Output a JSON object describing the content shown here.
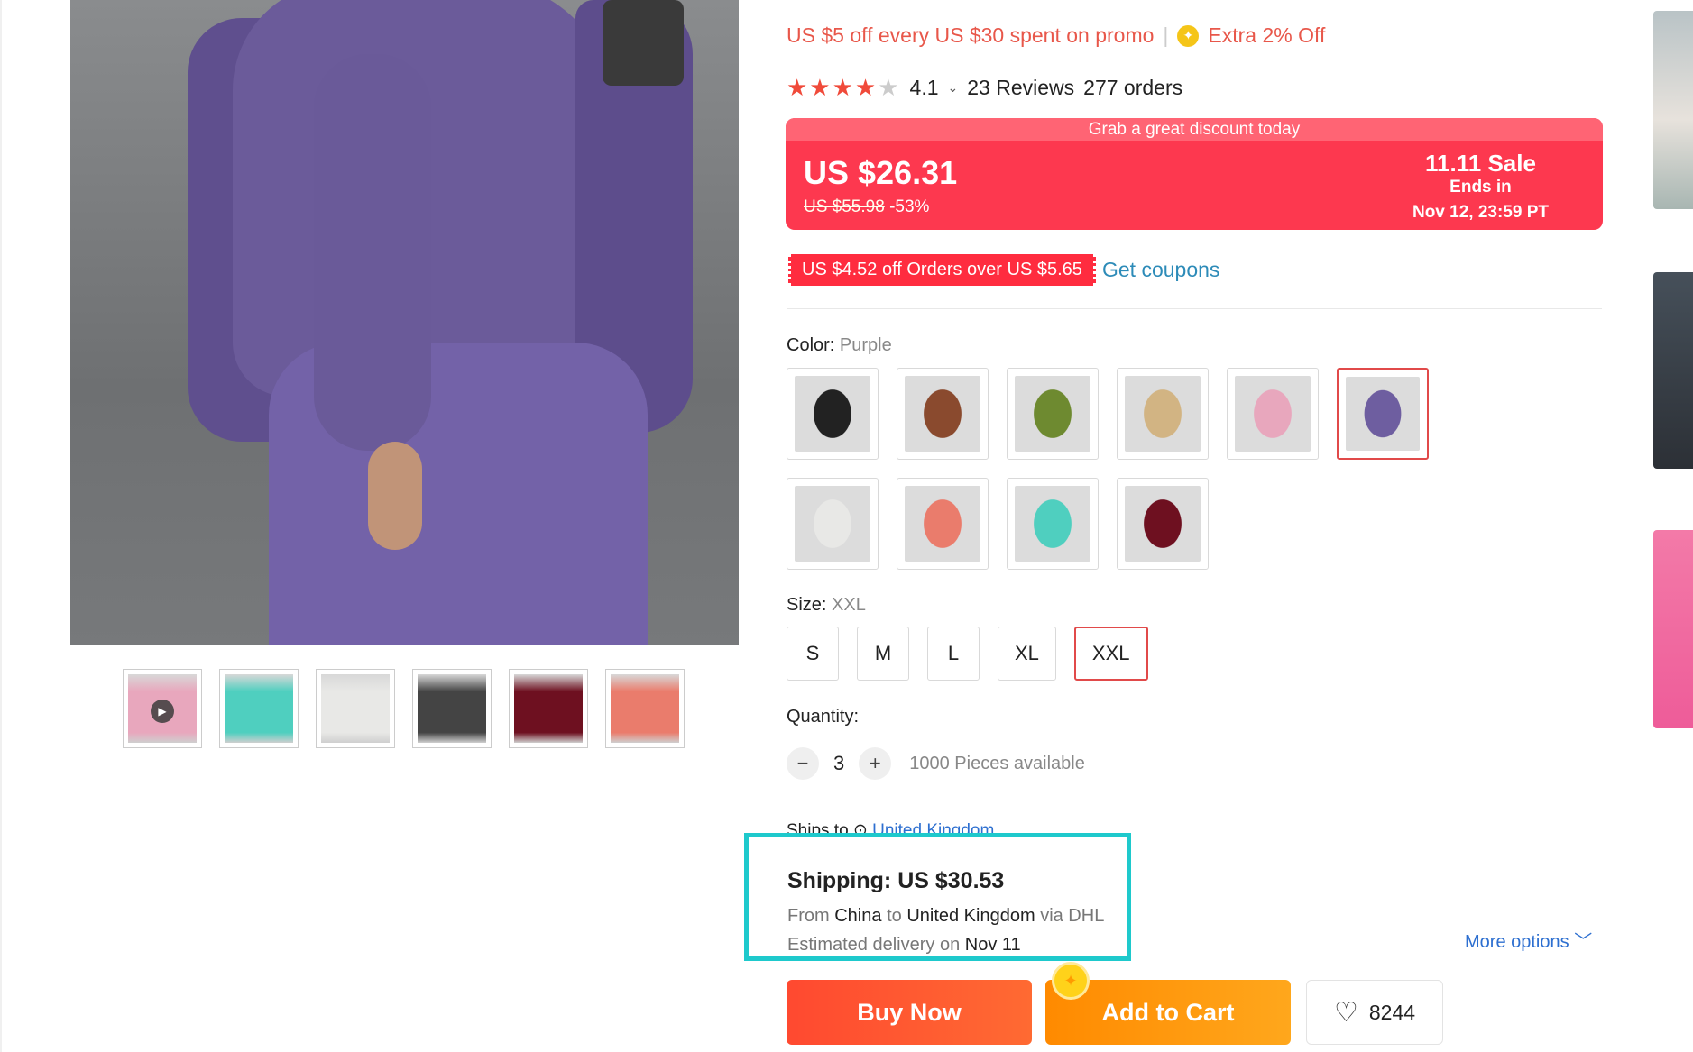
{
  "promo": {
    "text": "US $5 off every US $30 spent on promo",
    "extra": "Extra 2% Off"
  },
  "rating": {
    "value": "4.1",
    "reviews": "23 Reviews",
    "orders": "277 orders"
  },
  "price_box": {
    "banner": "Grab a great discount today",
    "price": "US $26.31",
    "original": "US $55.98",
    "discount": "-53%",
    "sale_title": "11.11 Sale",
    "sale_ends": "Ends in",
    "sale_date": "Nov 12, 23:59 PT",
    "color": "#fd384f"
  },
  "coupon": {
    "text": "US $4.52 off Orders over US $5.65",
    "link": "Get coupons"
  },
  "color": {
    "label": "Color:",
    "selected": "Purple",
    "swatches": [
      {
        "name": "Black",
        "hex": "#222222"
      },
      {
        "name": "Brown",
        "hex": "#8a4a2e"
      },
      {
        "name": "Green",
        "hex": "#6e8a30"
      },
      {
        "name": "Khaki",
        "hex": "#d2b483"
      },
      {
        "name": "Pink",
        "hex": "#e8a7bd"
      },
      {
        "name": "Purple",
        "hex": "#6e5ea0"
      },
      {
        "name": "White",
        "hex": "#e8e8e6"
      },
      {
        "name": "Watermelon",
        "hex": "#ea7c6c"
      },
      {
        "name": "Teal",
        "hex": "#4fcfbf"
      },
      {
        "name": "Burgundy",
        "hex": "#6e1020"
      }
    ]
  },
  "size": {
    "label": "Size:",
    "selected": "XXL",
    "options": [
      "S",
      "M",
      "L",
      "XL",
      "XXL"
    ]
  },
  "quantity": {
    "label": "Quantity:",
    "value": "3",
    "minus": "−",
    "plus": "+",
    "available": "1000 Pieces available"
  },
  "ships_to": {
    "label": "Ships to",
    "location": "United Kingdom"
  },
  "shipping": {
    "title": "Shipping: US $30.53",
    "from_label": "From",
    "from": "China",
    "to_label": "to",
    "to": "United Kingdom",
    "via_label": "via DHL",
    "est_label": "Estimated delivery on",
    "est_date": "Nov 11",
    "highlight": "#1ec9cc"
  },
  "more_options": "More options",
  "actions": {
    "buy": "Buy Now",
    "cart": "Add to Cart",
    "wishlist_count": "8244"
  },
  "thumbnails": [
    {
      "hex": "#e8a7bd",
      "video": true
    },
    {
      "hex": "#4fcfbf"
    },
    {
      "hex": "#e8e8e6"
    },
    {
      "hex": "#444444"
    },
    {
      "hex": "#6e1020"
    },
    {
      "hex": "#ea7c6c"
    }
  ]
}
